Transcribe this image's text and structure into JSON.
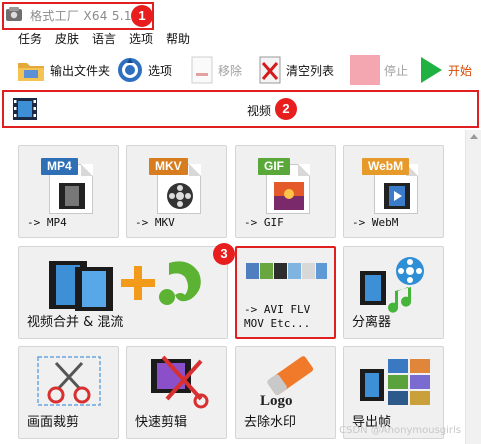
{
  "window": {
    "title": "格式工厂 X64 5.17"
  },
  "badges": [
    "1",
    "2",
    "3"
  ],
  "menu": [
    "任务",
    "皮肤",
    "语言",
    "选项",
    "帮助"
  ],
  "toolbar": {
    "output_folder": "输出文件夹",
    "options": "选项",
    "remove": "移除",
    "clear_list": "清空列表",
    "stop": "停止",
    "start": "开始"
  },
  "section": {
    "title": "视频"
  },
  "tiles": {
    "mp4": {
      "tag": "MP4",
      "label": "-> MP4",
      "color": "#2e6fb5"
    },
    "mkv": {
      "tag": "MKV",
      "label": "-> MKV",
      "color": "#d87c20"
    },
    "gif": {
      "tag": "GIF",
      "label": "-> GIF",
      "color": "#5aa83a"
    },
    "webm": {
      "tag": "WebM",
      "label": "-> WebM",
      "color": "#e59a2a"
    },
    "merge": {
      "label": "视频合并 & 混流"
    },
    "other": {
      "label_line1": "-> AVI FLV",
      "label_line2": "MOV Etc..."
    },
    "splitter": {
      "label": "分离器"
    },
    "crop": {
      "label": "画面裁剪"
    },
    "quick_cut": {
      "label": "快速剪辑"
    },
    "remove_watermark": {
      "label": "去除水印",
      "logo_text": "Logo"
    },
    "export_frames": {
      "label": "导出帧"
    }
  },
  "watermark_text": "CSDN @Anonymousgirls",
  "colors": {
    "highlight": "#e02020",
    "badge": "#e81e1e",
    "start_green": "#1fb141",
    "stop_pink": "#f4a7b1"
  }
}
